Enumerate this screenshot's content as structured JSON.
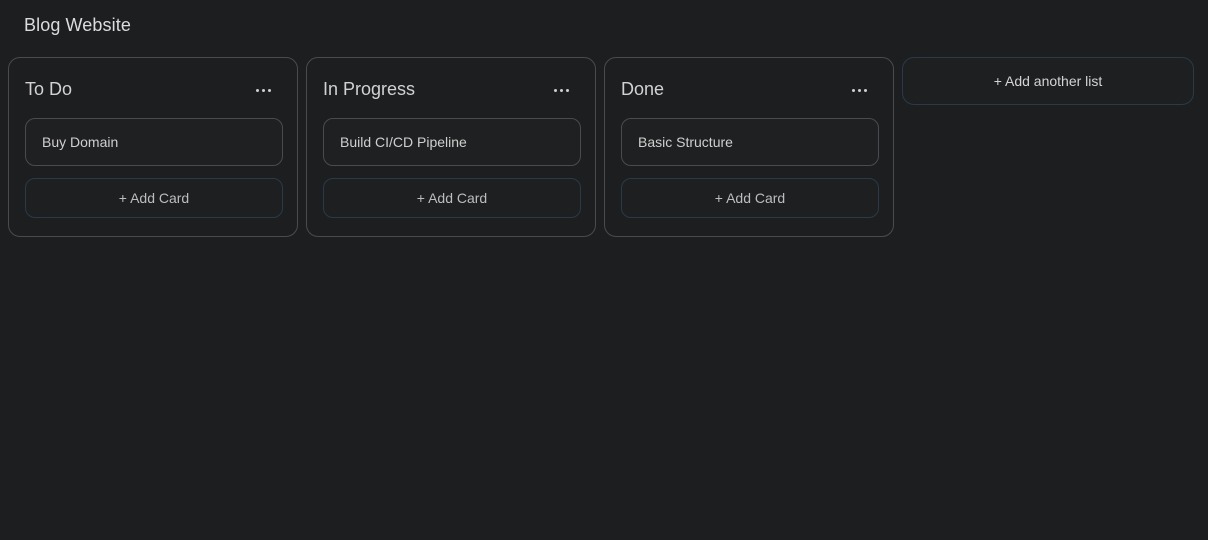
{
  "board": {
    "title": "Blog Website"
  },
  "lists": [
    {
      "title": "To Do",
      "menu_icon": "ellipsis-horizontal-icon",
      "cards": [
        "Buy Domain"
      ],
      "add_card_label": "+ Add Card"
    },
    {
      "title": "In Progress",
      "menu_icon": "ellipsis-horizontal-icon",
      "cards": [
        "Build CI/CD Pipeline"
      ],
      "add_card_label": "+ Add Card"
    },
    {
      "title": "Done",
      "menu_icon": "ellipsis-horizontal-icon",
      "cards": [
        "Basic Structure"
      ],
      "add_card_label": "+ Add Card"
    }
  ],
  "add_list_label": "+ Add another list",
  "colors": {
    "background": "#1d1e20",
    "border": "#4a4b4e",
    "accent_border": "#2a3a48",
    "text": "#d6d6d6"
  }
}
